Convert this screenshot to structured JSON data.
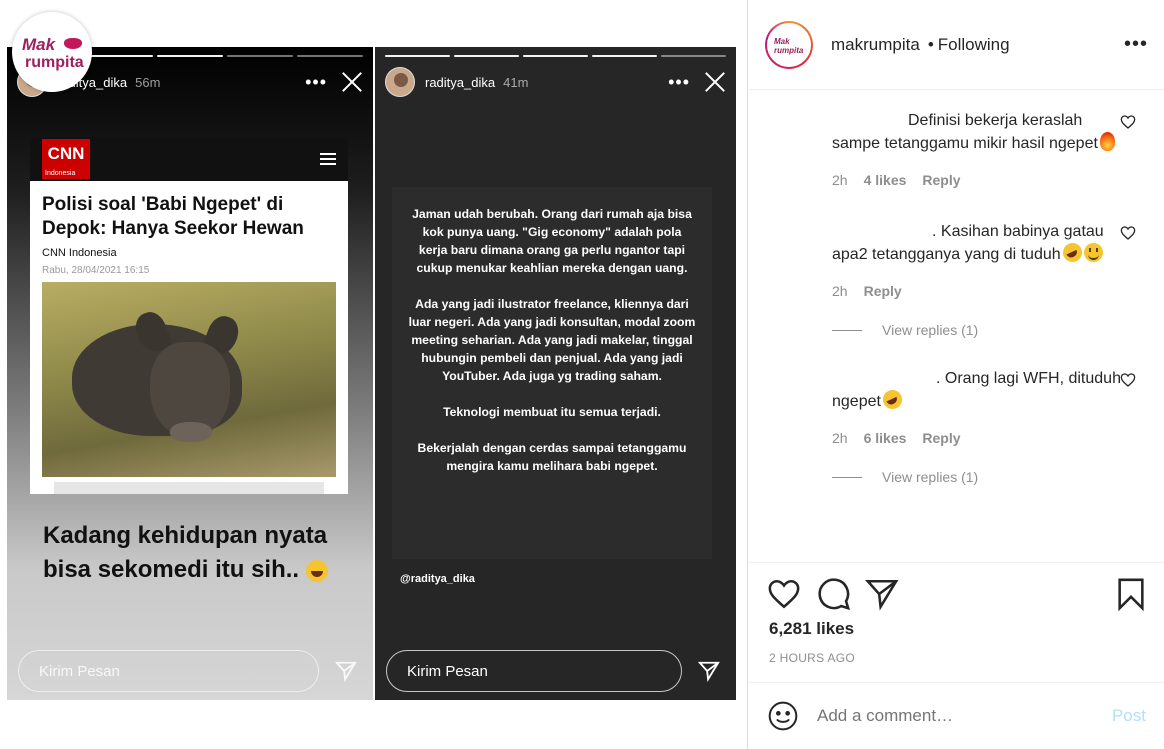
{
  "brand": {
    "line1": "Mak",
    "line2": "rumpita"
  },
  "story1": {
    "username": "raditya_dika",
    "time": "56m",
    "article": {
      "logo": "CNN",
      "logo_sub": "Indonesia",
      "title": "Polisi soal 'Babi Ngepet' di Depok: Hanya Seekor Hewan",
      "source": "CNN Indonesia",
      "date": "Rabu, 28/04/2021 16:15"
    },
    "caption": "Kadang kehidupan nyata bisa sekomedi itu sih..",
    "reply_placeholder": "Kirim Pesan"
  },
  "story2": {
    "username": "raditya_dika",
    "time": "41m",
    "paragraphs": [
      "Jaman udah berubah. Orang dari rumah aja bisa kok punya uang. \"Gig economy\" adalah pola kerja baru dimana orang ga perlu ngantor tapi cukup menukar keahlian mereka dengan uang.",
      "Ada yang jadi ilustrator freelance, kliennya dari luar negeri. Ada yang jadi konsultan, modal zoom meeting seharian. Ada yang jadi makelar, tinggal hubungin pembeli dan penjual. Ada yang jadi YouTuber. Ada juga yg trading saham.",
      "Teknologi membuat itu semua terjadi.",
      "Bekerjalah dengan cerdas sampai tetanggamu mengira kamu melihara babi ngepet."
    ],
    "mention": "@raditya_dika",
    "reply_placeholder": "Kirim Pesan"
  },
  "panel": {
    "avatar_text": "Mak rumpita",
    "username": "makrumpita",
    "separator": "•",
    "follow_status": "Following",
    "more": "•••"
  },
  "comments": [
    {
      "text": "Definisi bekerja keraslah sampe tetanggamu mikir hasil ngepet",
      "emoji": [
        "fire-emoji"
      ],
      "time": "2h",
      "likes": "4 likes",
      "reply": "Reply"
    },
    {
      "text": ". Kasihan babinya gatau apa2 tetangganya yang di tuduh",
      "emoji": [
        "rofl-emoji",
        "smile-emoji"
      ],
      "time": "2h",
      "likes": "",
      "reply": "Reply",
      "view_replies": "View replies (1)"
    },
    {
      "text": ". Orang lagi WFH, dituduh ngepet",
      "emoji": [
        "rofl-emoji"
      ],
      "time": "2h",
      "likes": "6 likes",
      "reply": "Reply",
      "view_replies": "View replies (1)"
    }
  ],
  "post": {
    "likes": "6,281 likes",
    "time_ago": "2 HOURS AGO"
  },
  "add_comment": {
    "placeholder": "Add a comment…",
    "post_label": "Post"
  },
  "colors": {
    "brand": "#9d1f5b",
    "link_disabled": "#b2dffc",
    "muted": "#8e8e8e"
  }
}
